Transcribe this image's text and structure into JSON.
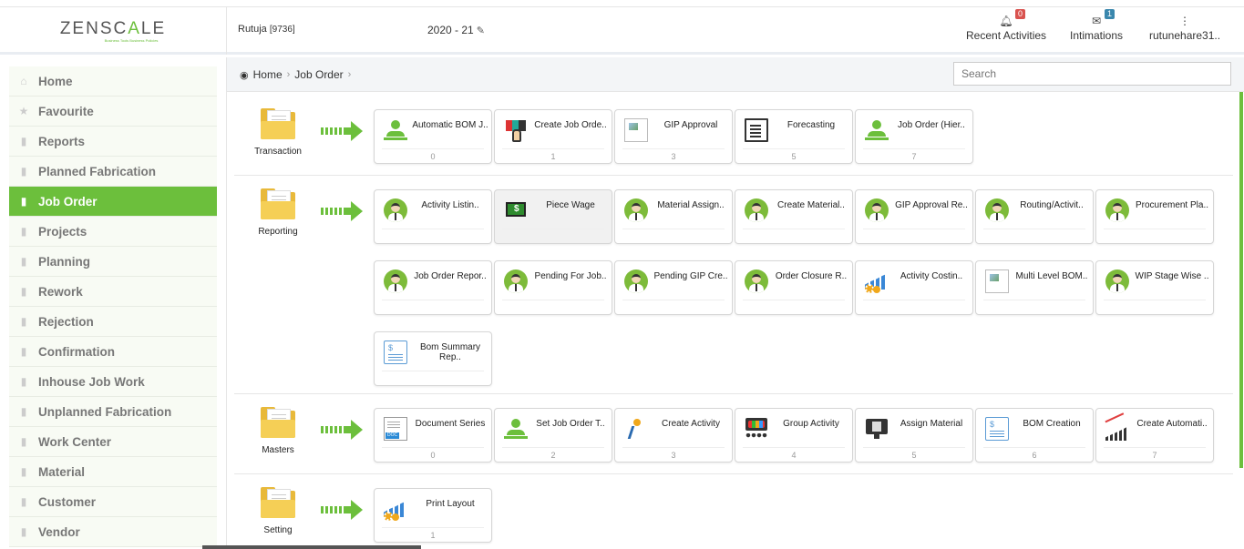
{
  "header": {
    "logo_text_1": "ZENSC",
    "logo_text_accent": "A",
    "logo_text_2": "LE",
    "logo_tagline": "Business Tools Business Policies",
    "user": "Rutuja",
    "user_id": "[9736]",
    "fiscal_year": "2020 - 21",
    "recent_activities_label": "Recent Activities",
    "recent_activities_count": "0",
    "intimations_label": "Intimations",
    "intimations_count": "1",
    "user_menu_label": "rutunehare31.."
  },
  "sidebar": {
    "items": [
      {
        "label": "Home",
        "icon": "home-icon"
      },
      {
        "label": "Favourite",
        "icon": "star-icon"
      },
      {
        "label": "Reports",
        "icon": "file-icon"
      },
      {
        "label": "Planned Fabrication",
        "icon": "folder-icon"
      },
      {
        "label": "Job Order",
        "icon": "folder-icon",
        "active": true
      },
      {
        "label": "Projects",
        "icon": "file-icon"
      },
      {
        "label": "Planning",
        "icon": "file-icon"
      },
      {
        "label": "Rework",
        "icon": "file-icon"
      },
      {
        "label": "Rejection",
        "icon": "file-icon"
      },
      {
        "label": "Confirmation",
        "icon": "file-icon"
      },
      {
        "label": "Inhouse Job Work",
        "icon": "file-icon"
      },
      {
        "label": "Unplanned Fabrication",
        "icon": "file-icon"
      },
      {
        "label": "Work Center",
        "icon": "file-icon"
      },
      {
        "label": "Material",
        "icon": "file-icon"
      },
      {
        "label": "Customer",
        "icon": "file-icon"
      },
      {
        "label": "Vendor",
        "icon": "file-icon"
      }
    ]
  },
  "breadcrumb": {
    "home": "Home",
    "current": "Job Order"
  },
  "search": {
    "placeholder": "Search"
  },
  "sections": {
    "transaction": {
      "label": "Transaction",
      "tiles": [
        {
          "label": "Automatic BOM J..",
          "count": "0"
        },
        {
          "label": "Create Job Orde..",
          "count": "1"
        },
        {
          "label": "GIP Approval",
          "count": "3"
        },
        {
          "label": "Forecasting",
          "count": "5"
        },
        {
          "label": "Job Order (Hier..",
          "count": "7"
        }
      ]
    },
    "reporting": {
      "label": "Reporting",
      "tiles": [
        {
          "label": "Activity Listin.."
        },
        {
          "label": "Piece Wage"
        },
        {
          "label": "Material Assign.."
        },
        {
          "label": "Create Material.."
        },
        {
          "label": "GIP Approval Re.."
        },
        {
          "label": "Routing/Activit.."
        },
        {
          "label": "Procurement Pla.."
        },
        {
          "label": "Job Order Repor.."
        },
        {
          "label": "Pending For Job.."
        },
        {
          "label": "Pending GIP Cre.."
        },
        {
          "label": "Order Closure R.."
        },
        {
          "label": "Activity Costin.."
        },
        {
          "label": "Multi Level BOM.."
        },
        {
          "label": "WIP Stage Wise .."
        },
        {
          "label": "Bom Summary Rep.."
        }
      ]
    },
    "masters": {
      "label": "Masters",
      "tiles": [
        {
          "label": "Document Series",
          "count": "0"
        },
        {
          "label": "Set Job Order T..",
          "count": "2"
        },
        {
          "label": "Create Activity",
          "count": "3"
        },
        {
          "label": "Group Activity",
          "count": "4"
        },
        {
          "label": "Assign Material",
          "count": "5"
        },
        {
          "label": "BOM Creation",
          "count": "6"
        },
        {
          "label": "Create Automati..",
          "count": "7"
        }
      ]
    },
    "setting": {
      "label": "Setting",
      "tiles": [
        {
          "label": "Print Layout",
          "count": "1"
        }
      ]
    }
  },
  "colors": {
    "accent": "#6cbf3c",
    "folder": "#f5cf56"
  }
}
